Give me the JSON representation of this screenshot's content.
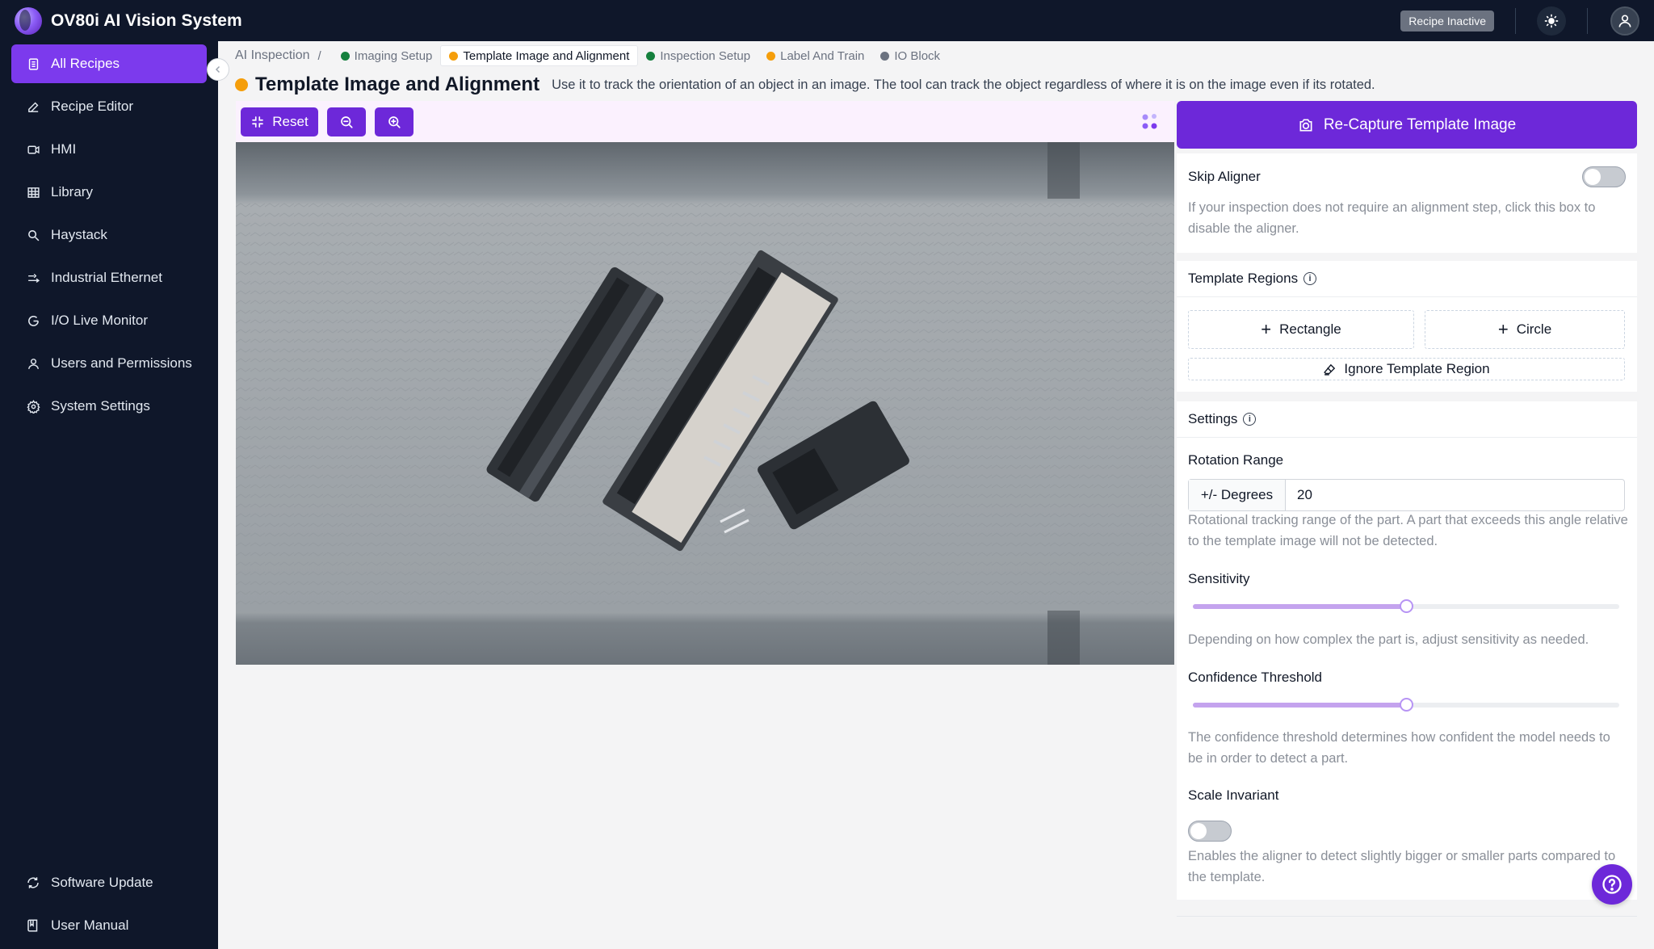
{
  "app": {
    "title": "OV80i AI Vision System",
    "status_badge": "Recipe Inactive"
  },
  "sidebar": {
    "items": [
      {
        "label": "All Recipes",
        "icon": "list-icon",
        "active": true
      },
      {
        "label": "Recipe Editor",
        "icon": "pencil-icon"
      },
      {
        "label": "HMI",
        "icon": "video-icon"
      },
      {
        "label": "Library",
        "icon": "grid-icon"
      },
      {
        "label": "Haystack",
        "icon": "search-icon"
      },
      {
        "label": "Industrial Ethernet",
        "icon": "ethernet-icon"
      },
      {
        "label": "I/O Live Monitor",
        "icon": "monitor-icon"
      },
      {
        "label": "Users and Permissions",
        "icon": "user-icon"
      },
      {
        "label": "System Settings",
        "icon": "gear-icon"
      }
    ],
    "bottom": [
      {
        "label": "Software Update",
        "icon": "refresh-icon"
      },
      {
        "label": "User Manual",
        "icon": "book-icon"
      }
    ]
  },
  "breadcrumb": {
    "root": "AI Inspection",
    "separator": "/",
    "steps": [
      {
        "label": "Imaging Setup",
        "color": "#15803d"
      },
      {
        "label": "Template Image and Alignment",
        "color": "#f59e0b",
        "current": true
      },
      {
        "label": "Inspection Setup",
        "color": "#15803d"
      },
      {
        "label": "Label And Train",
        "color": "#f59e0b"
      },
      {
        "label": "IO Block",
        "color": "#6b7280"
      }
    ]
  },
  "page": {
    "title": "Template Image and Alignment",
    "description": "Use it to track the orientation of an object in an image. The tool can track the object regardless of where it is on the image even if its rotated."
  },
  "toolbar": {
    "reset_label": "Reset"
  },
  "panel": {
    "capture_label": "Re-Capture Template Image",
    "skip_aligner": {
      "title": "Skip Aligner",
      "enabled": false,
      "help": "If your inspection does not require an alignment step, click this box to disable the aligner."
    },
    "template_regions": {
      "title": "Template Regions",
      "rectangle_label": "Rectangle",
      "circle_label": "Circle",
      "ignore_label": "Ignore Template Region"
    },
    "settings": {
      "title": "Settings",
      "rotation": {
        "label": "Rotation Range",
        "unit": "+/- Degrees",
        "value": "20",
        "help": "Rotational tracking range of the part. A part that exceeds this angle relative to the template image will not be detected."
      },
      "sensitivity": {
        "label": "Sensitivity",
        "level": 0.5,
        "help": "Depending on how complex the part is, adjust sensitivity as needed."
      },
      "confidence": {
        "label": "Confidence Threshold",
        "level": 0.5,
        "help": "The confidence threshold determines how confident the model needs to be in order to detect a part."
      },
      "scale_invariant": {
        "label": "Scale Invariant",
        "enabled": false,
        "help": "Enables the aligner to detect slightly bigger or smaller parts compared to the template."
      }
    }
  },
  "colors": {
    "accent": "#6d28d9",
    "nav_bg": "#0f172a",
    "active_nav": "#7c3aed"
  }
}
